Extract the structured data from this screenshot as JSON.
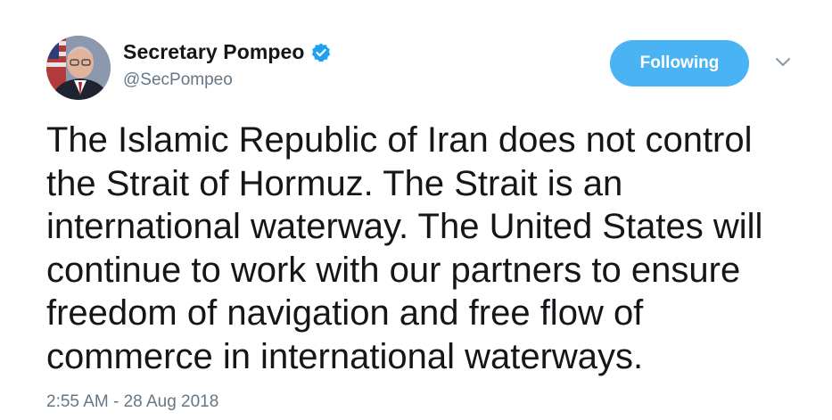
{
  "header": {
    "display_name": "Secretary Pompeo",
    "handle": "@SecPompeo",
    "verified_icon": "verified-badge-icon",
    "follow_button_label": "Following",
    "menu_icon": "chevron-down-icon"
  },
  "tweet": {
    "text": "The Islamic Republic of Iran does not control\nthe Strait of Hormuz. The Strait is an\ninternational waterway. The United States will\ncontinue to work with our partners to ensure\nfreedom of navigation and free flow of\ncommerce in international waterways.",
    "timestamp": "2:55 AM - 28 Aug 2018"
  },
  "colors": {
    "accent": "#4ab3f4",
    "verified": "#1da1f2",
    "secondary_text": "#657786",
    "primary_text": "#14171a"
  }
}
